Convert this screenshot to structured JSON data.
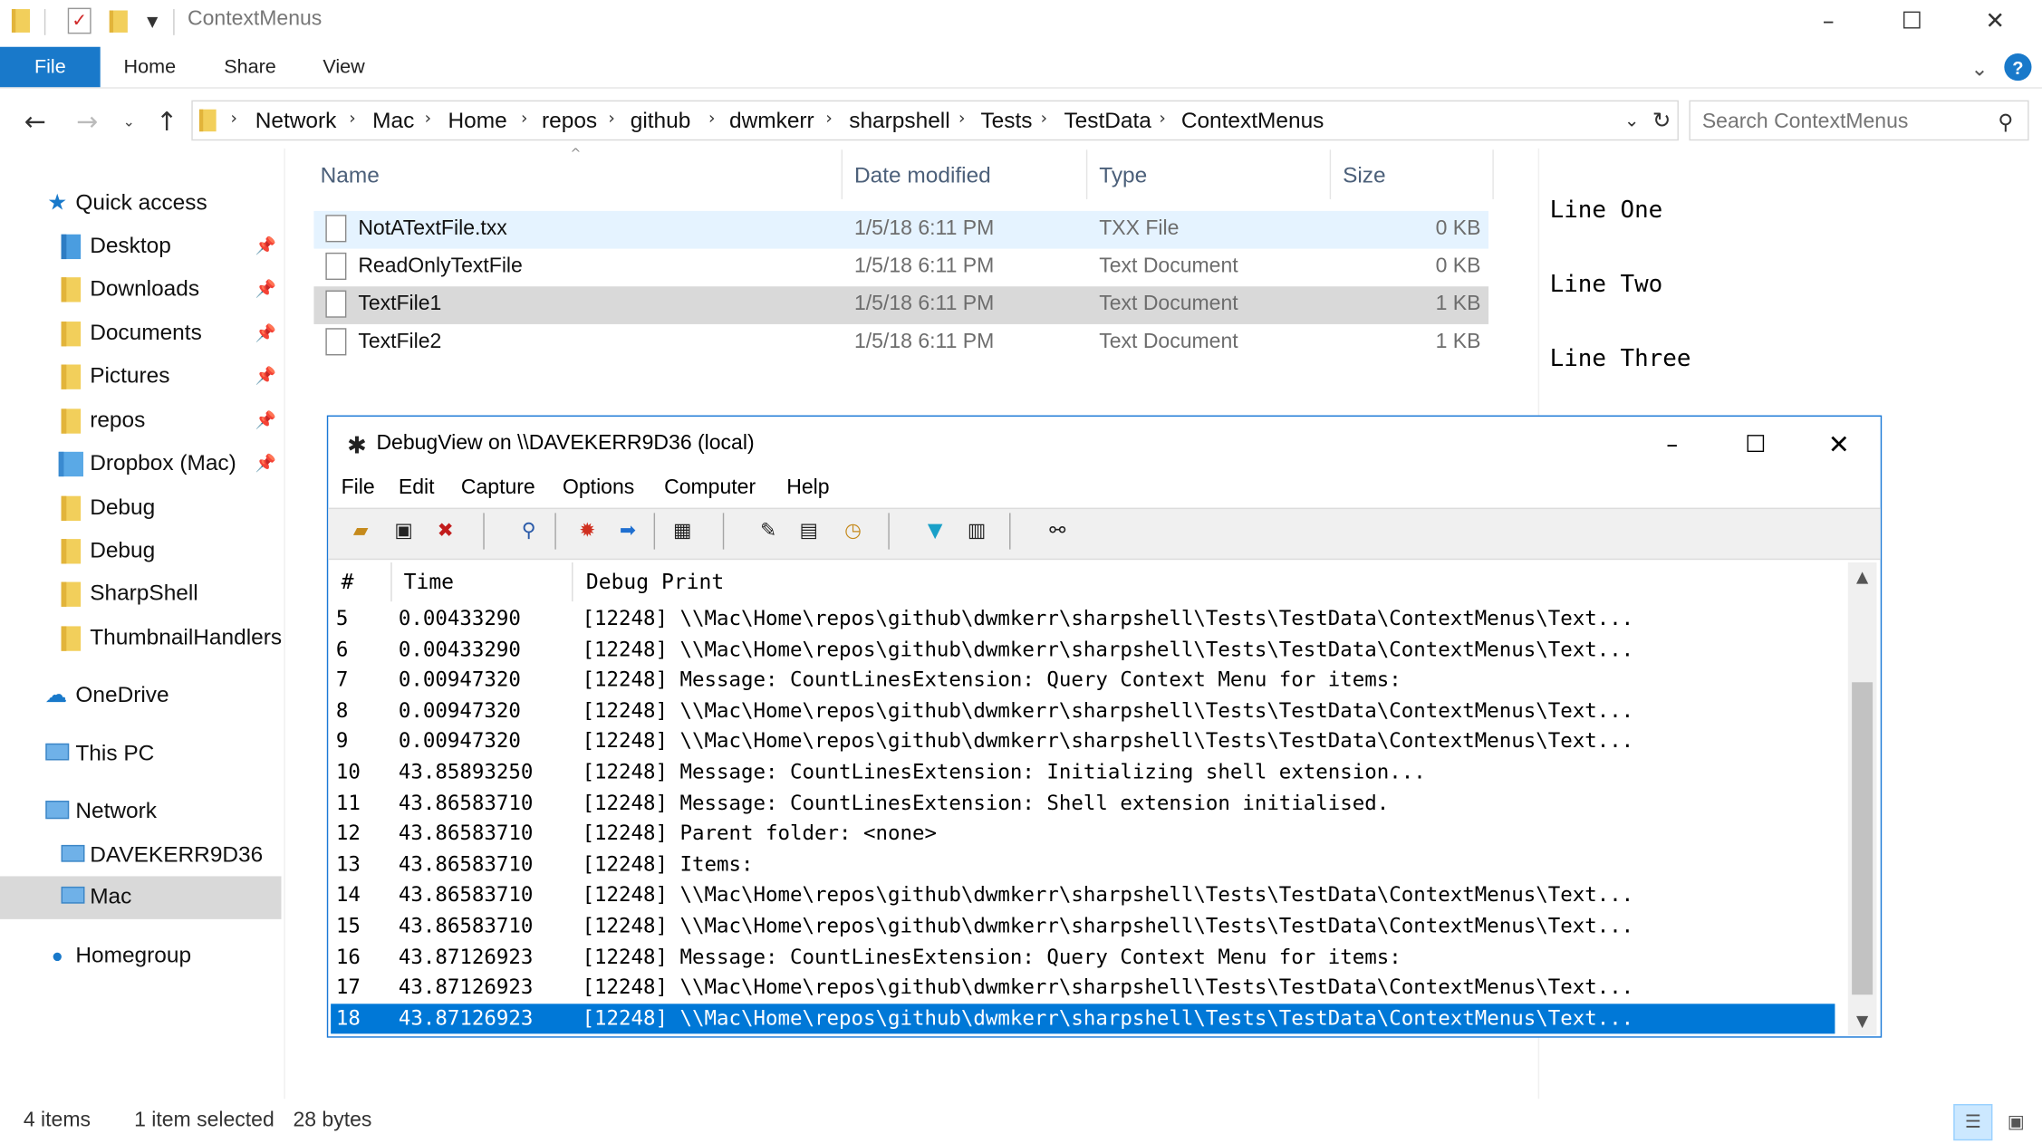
{
  "window": {
    "title": "ContextMenus",
    "controls": [
      "–",
      "☐",
      "✕"
    ]
  },
  "ribbon": {
    "file_label": "File",
    "tabs": [
      "Home",
      "Share",
      "View"
    ],
    "help_label": "?"
  },
  "address": {
    "breadcrumbs": [
      "Network",
      "Mac",
      "Home",
      "repos",
      "github",
      "dwmkerr",
      "sharpshell",
      "Tests",
      "TestData",
      "ContextMenus"
    ],
    "search_placeholder": "Search ContextMenus"
  },
  "nav": {
    "items": [
      {
        "label": "Quick access",
        "icon": "star-icon",
        "pinned": false
      },
      {
        "label": "Desktop",
        "icon": "folder-icon",
        "pinned": true
      },
      {
        "label": "Downloads",
        "icon": "folder-icon",
        "pinned": true
      },
      {
        "label": "Documents",
        "icon": "folder-icon",
        "pinned": true
      },
      {
        "label": "Pictures",
        "icon": "folder-icon",
        "pinned": true
      },
      {
        "label": "repos",
        "icon": "folder-icon",
        "pinned": true
      },
      {
        "label": "Dropbox (Mac)",
        "icon": "folder-icon",
        "pinned": true
      },
      {
        "label": "Debug",
        "icon": "folder-icon",
        "pinned": false
      },
      {
        "label": "Debug",
        "icon": "folder-icon",
        "pinned": false
      },
      {
        "label": "SharpShell",
        "icon": "folder-icon",
        "pinned": false
      },
      {
        "label": "ThumbnailHandlers",
        "icon": "folder-icon",
        "pinned": false
      },
      {
        "label": "OneDrive",
        "icon": "cloud-icon",
        "pinned": false
      },
      {
        "label": "This PC",
        "icon": "computer-icon",
        "pinned": false
      },
      {
        "label": "Network",
        "icon": "network-icon",
        "pinned": false
      },
      {
        "label": "DAVEKERR9D36",
        "icon": "computer-icon",
        "pinned": false
      },
      {
        "label": "Mac",
        "icon": "computer-icon",
        "pinned": false
      },
      {
        "label": "Homegroup",
        "icon": "homegroup-icon",
        "pinned": false
      }
    ]
  },
  "filelist": {
    "columns": [
      "Name",
      "Date modified",
      "Type",
      "Size"
    ],
    "rows": [
      {
        "name": "NotATextFile.txx",
        "date": "1/5/18 6:11 PM",
        "type": "TXX File",
        "size": "0 KB"
      },
      {
        "name": "ReadOnlyTextFile",
        "date": "1/5/18 6:11 PM",
        "type": "Text Document",
        "size": "0 KB"
      },
      {
        "name": "TextFile1",
        "date": "1/5/18 6:11 PM",
        "type": "Text Document",
        "size": "1 KB"
      },
      {
        "name": "TextFile2",
        "date": "1/5/18 6:11 PM",
        "type": "Text Document",
        "size": "1 KB"
      }
    ]
  },
  "preview": {
    "lines": [
      "Line One",
      "Line Two",
      "Line Three"
    ]
  },
  "debugview": {
    "title": "DebugView on \\\\DAVEKERR9D36 (local)",
    "menu": [
      "File",
      "Edit",
      "Capture",
      "Options",
      "Computer",
      "Help"
    ],
    "columns": [
      "#",
      "Time",
      "Debug Print"
    ],
    "rows": [
      {
        "n": "5",
        "t": "0.00433290",
        "p": "[12248] \\\\Mac\\Home\\repos\\github\\dwmkerr\\sharpshell\\Tests\\TestData\\ContextMenus\\Text..."
      },
      {
        "n": "6",
        "t": "0.00433290",
        "p": "[12248] \\\\Mac\\Home\\repos\\github\\dwmkerr\\sharpshell\\Tests\\TestData\\ContextMenus\\Text..."
      },
      {
        "n": "7",
        "t": "0.00947320",
        "p": "[12248] Message: CountLinesExtension: Query Context Menu for items:"
      },
      {
        "n": "8",
        "t": "0.00947320",
        "p": "[12248] \\\\Mac\\Home\\repos\\github\\dwmkerr\\sharpshell\\Tests\\TestData\\ContextMenus\\Text..."
      },
      {
        "n": "9",
        "t": "0.00947320",
        "p": "[12248] \\\\Mac\\Home\\repos\\github\\dwmkerr\\sharpshell\\Tests\\TestData\\ContextMenus\\Text..."
      },
      {
        "n": "10",
        "t": "43.85893250",
        "p": "[12248] Message: CountLinesExtension: Initializing shell extension..."
      },
      {
        "n": "11",
        "t": "43.86583710",
        "p": "[12248] Message: CountLinesExtension: Shell extension initialised."
      },
      {
        "n": "12",
        "t": "43.86583710",
        "p": "[12248] Parent folder: <none>"
      },
      {
        "n": "13",
        "t": "43.86583710",
        "p": "[12248] Items:"
      },
      {
        "n": "14",
        "t": "43.86583710",
        "p": "[12248] \\\\Mac\\Home\\repos\\github\\dwmkerr\\sharpshell\\Tests\\TestData\\ContextMenus\\Text..."
      },
      {
        "n": "15",
        "t": "43.86583710",
        "p": "[12248] \\\\Mac\\Home\\repos\\github\\dwmkerr\\sharpshell\\Tests\\TestData\\ContextMenus\\Text..."
      },
      {
        "n": "16",
        "t": "43.87126923",
        "p": "[12248] Message: CountLinesExtension: Query Context Menu for items:"
      },
      {
        "n": "17",
        "t": "43.87126923",
        "p": "[12248] \\\\Mac\\Home\\repos\\github\\dwmkerr\\sharpshell\\Tests\\TestData\\ContextMenus\\Text..."
      },
      {
        "n": "18",
        "t": "43.87126923",
        "p": "[12248] \\\\Mac\\Home\\repos\\github\\dwmkerr\\sharpshell\\Tests\\TestData\\ContextMenus\\Text..."
      }
    ]
  },
  "status": {
    "items_count": "4 items",
    "selection": "1 item selected",
    "size": "28 bytes"
  },
  "colors": {
    "accent": "#1979ca",
    "selection_hover": "#e5f3ff",
    "selection_inactive": "#d9d9d9",
    "debug_selected": "#0078d7"
  }
}
